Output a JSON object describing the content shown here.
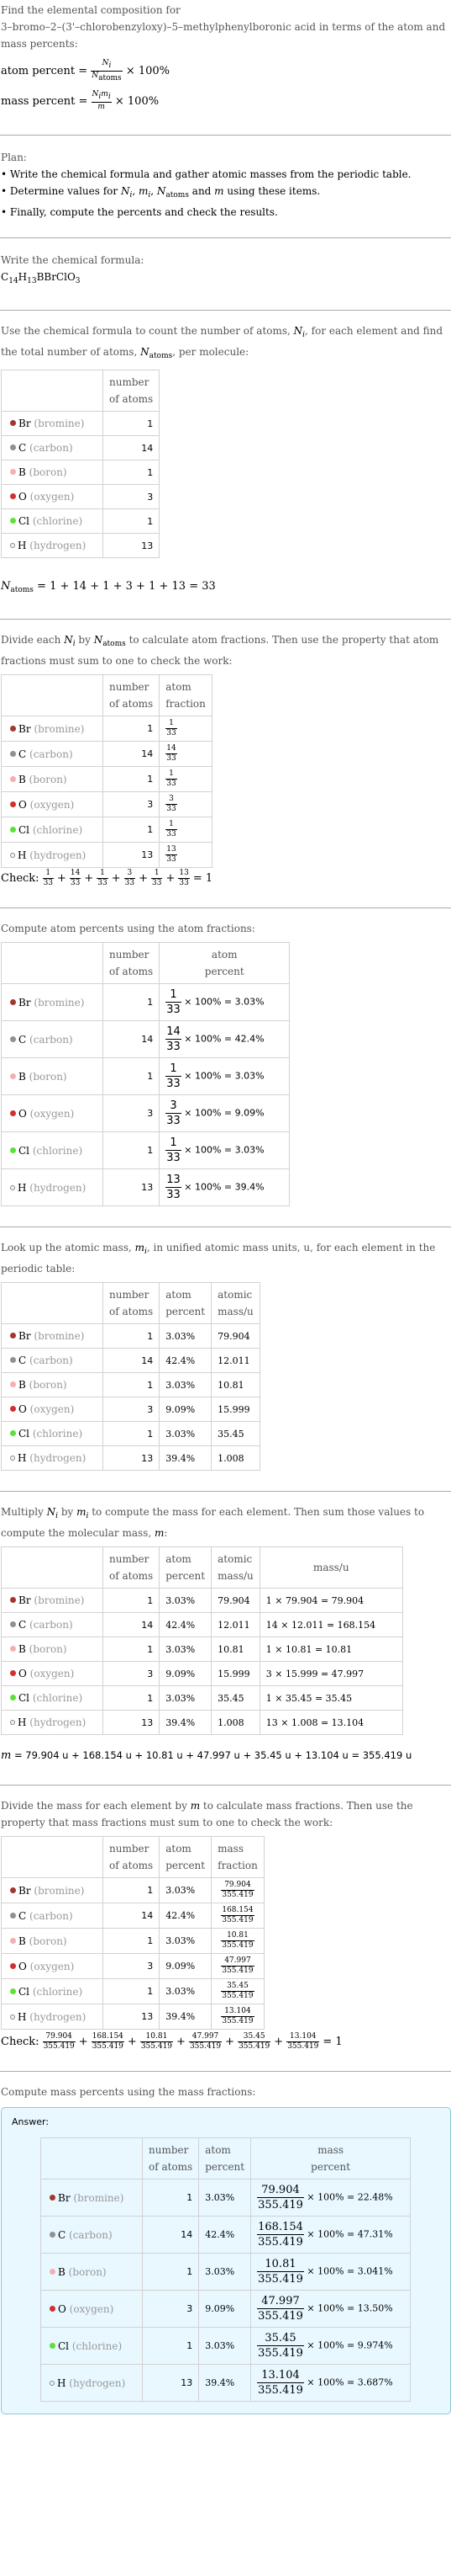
{
  "intro": {
    "line1": "Find the elemental composition for",
    "line2": "3–bromo–2–(3'–chlorobenzyloxy)–5–methylphenylboronic acid in terms of the atom and mass percents:",
    "atom_percent_label": "atom percent =",
    "mass_percent_label": "mass percent =",
    "times_100": "× 100%",
    "Ni": "N",
    "i": "i",
    "Natoms": "N",
    "atoms": "atoms",
    "mi": "m",
    "m": "m"
  },
  "plan": {
    "title": "Plan:",
    "items": [
      "Write the chemical formula and gather atomic masses from the periodic table.",
      "Determine values for N_i, m_i, N_atoms and m using these items.",
      "Finally, compute the percents and check the results."
    ],
    "item2_parts": {
      "pre": "Determine values for ",
      "post": " and ",
      "end": " using these items."
    }
  },
  "formula_section": {
    "title": "Write the chemical formula:",
    "formula_parts": [
      {
        "t": "C",
        "s": "14"
      },
      {
        "t": "H",
        "s": "13"
      },
      {
        "t": "BBrClO",
        "s": "3"
      }
    ]
  },
  "count_section": {
    "text_a": "Use the chemical formula to count the number of atoms, ",
    "text_b": ", for each element and find the total number of atoms, ",
    "text_c": ", per molecule:",
    "natoms_eq": "= 1 + 14 + 1 + 3 + 1 + 13 = 33"
  },
  "headers": {
    "number_of_atoms": [
      "number",
      "of atoms"
    ],
    "atom_fraction": [
      "atom",
      "fraction"
    ],
    "atom_percent": [
      "atom",
      "percent"
    ],
    "atomic_mass": [
      "atomic",
      "mass/u"
    ],
    "mass": "mass/u",
    "mass_fraction": [
      "mass",
      "fraction"
    ],
    "mass_percent": [
      "mass",
      "percent"
    ]
  },
  "elements": [
    {
      "symbol": "Br",
      "name": "(bromine)",
      "color": "#a0382f",
      "count": "1",
      "frac_num": "1",
      "frac_den": "33",
      "atom_percent": "3.03%",
      "atomic_mass": "79.904",
      "mass_calc": "1 × 79.904 = 79.904",
      "mass": "79.904",
      "mass_percent": "22.48%"
    },
    {
      "symbol": "C",
      "name": "(carbon)",
      "color": "#909090",
      "count": "14",
      "frac_num": "14",
      "frac_den": "33",
      "atom_percent": "42.4%",
      "atomic_mass": "12.011",
      "mass_calc": "14 × 12.011 = 168.154",
      "mass": "168.154",
      "mass_percent": "47.31%"
    },
    {
      "symbol": "B",
      "name": "(boron)",
      "color": "#f4b0b0",
      "count": "1",
      "frac_num": "1",
      "frac_den": "33",
      "atom_percent": "3.03%",
      "atomic_mass": "10.81",
      "mass_calc": "1 × 10.81 = 10.81",
      "mass": "10.81",
      "mass_percent": "3.041%"
    },
    {
      "symbol": "O",
      "name": "(oxygen)",
      "color": "#d03030",
      "count": "3",
      "frac_num": "3",
      "frac_den": "33",
      "atom_percent": "9.09%",
      "atomic_mass": "15.999",
      "mass_calc": "3 × 15.999 = 47.997",
      "mass": "47.997",
      "mass_percent": "13.50%"
    },
    {
      "symbol": "Cl",
      "name": "(chlorine)",
      "color": "#5ee03a",
      "count": "1",
      "frac_num": "1",
      "frac_den": "33",
      "atom_percent": "3.03%",
      "atomic_mass": "35.45",
      "mass_calc": "1 × 35.45 = 35.45",
      "mass": "35.45",
      "mass_percent": "9.974%"
    },
    {
      "symbol": "H",
      "name": "(hydrogen)",
      "color": "#e8f8fc",
      "count": "13",
      "frac_num": "13",
      "frac_den": "33",
      "atom_percent": "39.4%",
      "atomic_mass": "1.008",
      "mass_calc": "13 × 1.008 = 13.104",
      "mass": "13.104",
      "mass_percent": "3.687%",
      "hollow": true
    }
  ],
  "fraction_section": {
    "text_a": "Divide each ",
    "text_b": " by ",
    "text_c": " to calculate atom fractions. Then use the property that atom fractions must sum to one to check the work:",
    "check_label": "Check:",
    "check_result": "= 1"
  },
  "atom_percent_section": {
    "text": "Compute atom percents using the atom fractions:",
    "times_100": "× 100% ="
  },
  "mass_lookup_section": {
    "text_a": "Look up the atomic mass, ",
    "text_b": ", in unified atomic mass units, u, for each element in the periodic table:"
  },
  "molecular_mass_section": {
    "text_a": "Multiply ",
    "text_b": " by ",
    "text_c": " to compute the mass for each element. Then sum those values to compute the molecular mass, ",
    "text_d": ":",
    "sum_eq": "= 79.904 u + 168.154 u + 10.81 u + 47.997 u + 35.45 u + 13.104 u = 355.419 u",
    "total_mass": "355.419"
  },
  "mass_fraction_section": {
    "text_a": "Divide the mass for each element by ",
    "text_b": " to calculate mass fractions. Then use the property that mass fractions must sum to one to check the work:",
    "check_label": "Check:",
    "check_result": "= 1"
  },
  "mass_percent_section": {
    "text": "Compute mass percents using the mass fractions:",
    "answer_label": "Answer:",
    "times_100": "× 100% ="
  }
}
